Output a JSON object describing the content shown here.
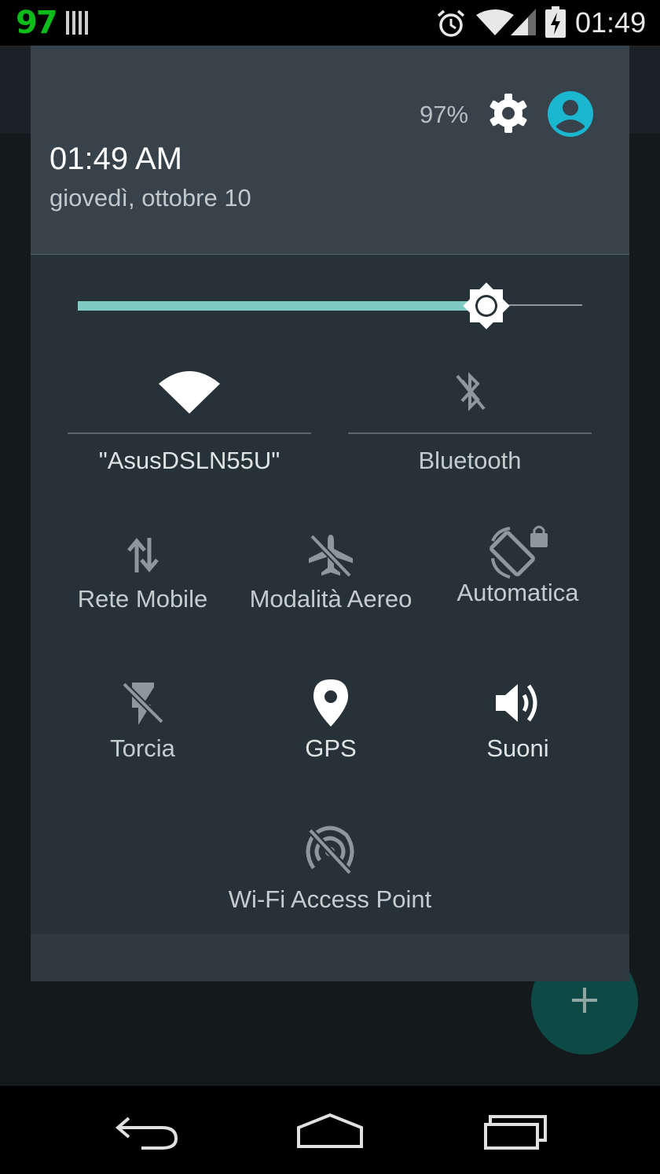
{
  "status_bar": {
    "left_number": "97",
    "time": "01:49"
  },
  "shade": {
    "clock": "01:49 AM",
    "date": "giovedì, ottobre 10",
    "battery_percent": "97%",
    "brightness_level": 0.81
  },
  "tiles": {
    "wifi": {
      "label": "\"AsusDSLN55U\"",
      "icon": "wifi-icon",
      "state": "on"
    },
    "bluetooth": {
      "label": "Bluetooth",
      "icon": "bluetooth-off-icon",
      "state": "off"
    },
    "mobile_data": {
      "label": "Rete Mobile",
      "icon": "data-arrows-icon",
      "state": "off"
    },
    "airplane": {
      "label": "Modalità Aereo",
      "icon": "airplane-off-icon",
      "state": "off"
    },
    "rotation": {
      "label": "Automatica",
      "icon": "rotation-lock-icon",
      "state": "off"
    },
    "flashlight": {
      "label": "Torcia",
      "icon": "flashlight-off-icon",
      "state": "off"
    },
    "gps": {
      "label": "GPS",
      "icon": "location-pin-icon",
      "state": "on"
    },
    "sound": {
      "label": "Suoni",
      "icon": "speaker-icon",
      "state": "on"
    },
    "hotspot": {
      "label": "Wi-Fi Access Point",
      "icon": "hotspot-off-icon",
      "state": "off"
    }
  },
  "colors": {
    "accent": "#7fcbc4",
    "avatar": "#1bb6d0",
    "shade_bg": "#263238",
    "header_bg": "#37424a",
    "indicator_green": "#0dbb1a"
  }
}
